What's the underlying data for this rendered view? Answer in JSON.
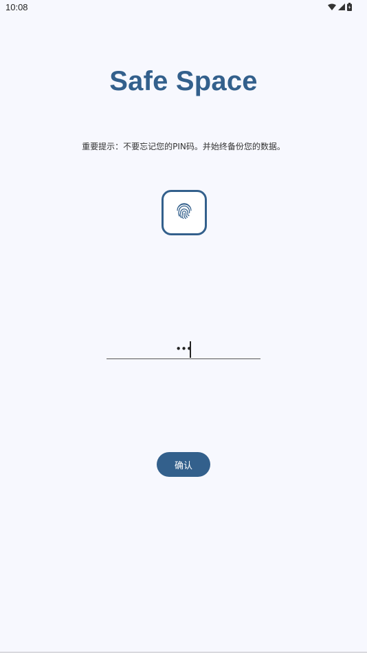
{
  "status_bar": {
    "time": "10:08",
    "icons": [
      "wifi-icon",
      "cellular-signal-icon",
      "battery-icon"
    ]
  },
  "app": {
    "title": "Safe Space",
    "notice": "重要提示：不要忘记您的PIN码。并始终备份您的数据。"
  },
  "fingerprint": {
    "icon": "fingerprint-icon"
  },
  "pin_input": {
    "value": "•••"
  },
  "confirm_button": {
    "label": "确认"
  },
  "colors": {
    "accent": "#33608c",
    "background": "#f7f8fe"
  }
}
